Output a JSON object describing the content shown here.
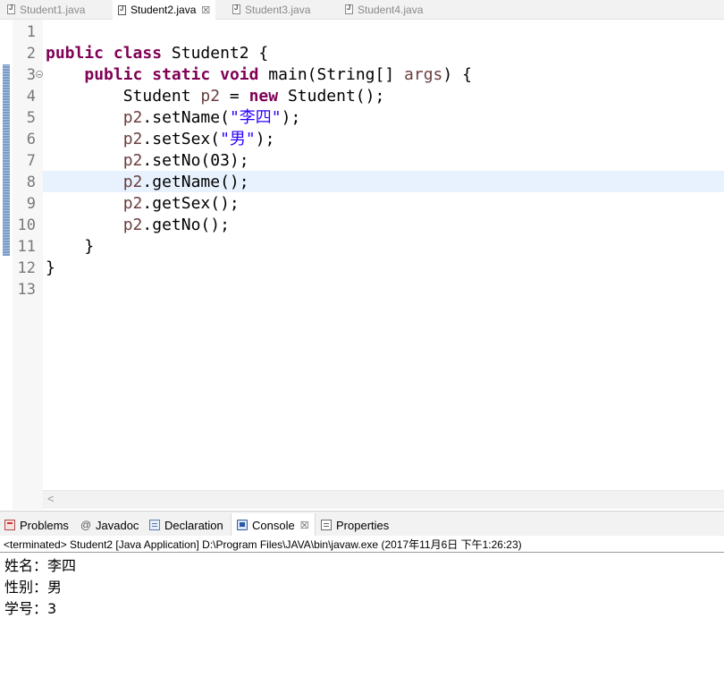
{
  "editor_tabs": [
    {
      "label": "Student1.java",
      "active": false,
      "icon": "java-file-icon"
    },
    {
      "label": "Student2.java",
      "active": true,
      "icon": "java-file-icon",
      "close": "☒"
    },
    {
      "label": "Student3.java",
      "active": false,
      "icon": "java-file-icon"
    },
    {
      "label": "Student4.java",
      "active": false,
      "icon": "java-file-icon"
    }
  ],
  "editor": {
    "line_numbers": [
      "1",
      "2",
      "3",
      "4",
      "5",
      "6",
      "7",
      "8",
      "9",
      "10",
      "11",
      "12",
      "13"
    ],
    "code": [
      {
        "tokens": []
      },
      {
        "tokens": [
          {
            "t": "public",
            "c": "kw"
          },
          {
            "t": " "
          },
          {
            "t": "class",
            "c": "kw"
          },
          {
            "t": " Student2 {"
          }
        ]
      },
      {
        "tokens": [
          {
            "t": "    "
          },
          {
            "t": "public",
            "c": "kw"
          },
          {
            "t": " "
          },
          {
            "t": "static",
            "c": "kw"
          },
          {
            "t": " "
          },
          {
            "t": "void",
            "c": "kw"
          },
          {
            "t": " main(String[] "
          },
          {
            "t": "args",
            "c": "var"
          },
          {
            "t": ") {"
          }
        ]
      },
      {
        "tokens": [
          {
            "t": "        Student "
          },
          {
            "t": "p2",
            "c": "var"
          },
          {
            "t": " = "
          },
          {
            "t": "new",
            "c": "kw"
          },
          {
            "t": " Student();"
          }
        ]
      },
      {
        "tokens": [
          {
            "t": "        "
          },
          {
            "t": "p2",
            "c": "var"
          },
          {
            "t": ".setName("
          },
          {
            "t": "\"李四\"",
            "c": "str"
          },
          {
            "t": ");"
          }
        ]
      },
      {
        "tokens": [
          {
            "t": "        "
          },
          {
            "t": "p2",
            "c": "var"
          },
          {
            "t": ".setSex("
          },
          {
            "t": "\"男\"",
            "c": "str"
          },
          {
            "t": ");"
          }
        ]
      },
      {
        "tokens": [
          {
            "t": "        "
          },
          {
            "t": "p2",
            "c": "var"
          },
          {
            "t": ".setNo(03);"
          }
        ]
      },
      {
        "tokens": [
          {
            "t": "        "
          },
          {
            "t": "p2",
            "c": "var"
          },
          {
            "t": ".getName();"
          }
        ]
      },
      {
        "tokens": [
          {
            "t": "        "
          },
          {
            "t": "p2",
            "c": "var"
          },
          {
            "t": ".getSex();"
          }
        ]
      },
      {
        "tokens": [
          {
            "t": "        "
          },
          {
            "t": "p2",
            "c": "var"
          },
          {
            "t": ".getNo();"
          }
        ]
      },
      {
        "tokens": [
          {
            "t": "    }"
          }
        ]
      },
      {
        "tokens": [
          {
            "t": "}"
          }
        ]
      },
      {
        "tokens": []
      }
    ],
    "current_line": 8,
    "scroll_left_glyph": "<"
  },
  "view_tabs": [
    {
      "label": "Problems",
      "icon": "problems-icon"
    },
    {
      "label": "Javadoc",
      "icon": "javadoc-icon",
      "glyph": "@"
    },
    {
      "label": "Declaration",
      "icon": "declaration-icon"
    },
    {
      "label": "Console",
      "icon": "console-icon",
      "active": true,
      "close": "☒"
    },
    {
      "label": "Properties",
      "icon": "properties-icon"
    }
  ],
  "console": {
    "status": "<terminated> Student2 [Java Application] D:\\Program Files\\JAVA\\bin\\javaw.exe (2017年11月6日 下午1:26:23)",
    "output": [
      "姓名：李四",
      "性别：男",
      "学号：3"
    ]
  },
  "colors": {
    "keyword": "#7f0055",
    "string": "#2a00ff",
    "variable": "#6a3e3e",
    "current_line": "#e8f2fe"
  }
}
